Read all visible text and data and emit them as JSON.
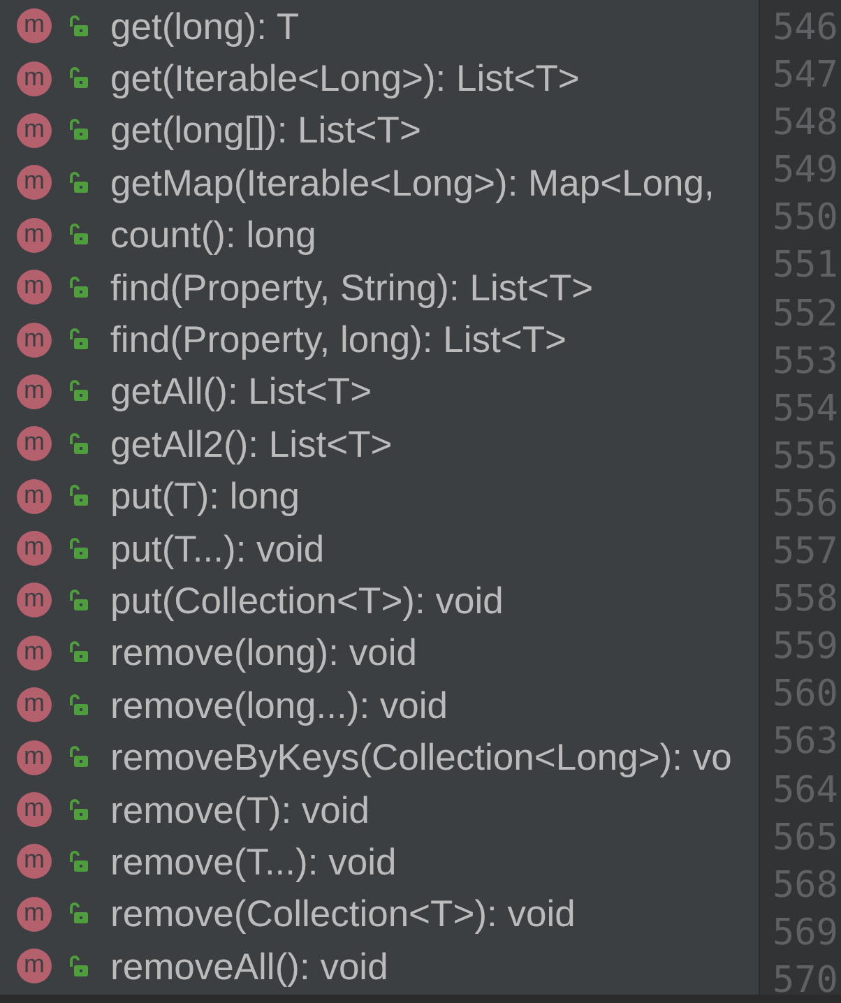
{
  "methods": [
    {
      "badge": "m",
      "signature": "get(long): T"
    },
    {
      "badge": "m",
      "signature": "get(Iterable<Long>): List<T>"
    },
    {
      "badge": "m",
      "signature": "get(long[]): List<T>"
    },
    {
      "badge": "m",
      "signature": "getMap(Iterable<Long>): Map<Long,"
    },
    {
      "badge": "m",
      "signature": "count(): long"
    },
    {
      "badge": "m",
      "signature": "find(Property, String): List<T>"
    },
    {
      "badge": "m",
      "signature": "find(Property, long): List<T>"
    },
    {
      "badge": "m",
      "signature": "getAll(): List<T>"
    },
    {
      "badge": "m",
      "signature": "getAll2(): List<T>"
    },
    {
      "badge": "m",
      "signature": "put(T): long"
    },
    {
      "badge": "m",
      "signature": "put(T...): void"
    },
    {
      "badge": "m",
      "signature": "put(Collection<T>): void"
    },
    {
      "badge": "m",
      "signature": "remove(long): void"
    },
    {
      "badge": "m",
      "signature": "remove(long...): void"
    },
    {
      "badge": "m",
      "signature": "removeByKeys(Collection<Long>): vo"
    },
    {
      "badge": "m",
      "signature": "remove(T): void"
    },
    {
      "badge": "m",
      "signature": "remove(T...): void"
    },
    {
      "badge": "m",
      "signature": "remove(Collection<T>): void"
    },
    {
      "badge": "m",
      "signature": "removeAll(): void"
    }
  ],
  "line_numbers": [
    "546",
    "547",
    "548",
    "549",
    "550",
    "551",
    "552",
    "553",
    "554",
    "555",
    "556",
    "557",
    "558",
    "559",
    "560",
    "563",
    "564",
    "565",
    "568",
    "569",
    "570"
  ]
}
